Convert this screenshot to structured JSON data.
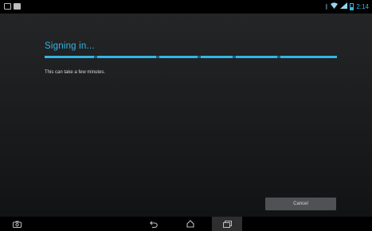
{
  "status_bar": {
    "left_icons": [
      "gallery-icon",
      "photo-icon"
    ],
    "right_icons": [
      "bluetooth-icon",
      "wifi-icon",
      "battery-icon"
    ],
    "time": "2:14"
  },
  "dialog": {
    "title": "Signing in...",
    "message": "This can take a few minutes.",
    "cancel_label": "Cancel"
  },
  "nav_bar": {
    "buttons": [
      "screenshot-icon",
      "back-icon",
      "home-icon",
      "recent-apps-icon"
    ]
  },
  "colors": {
    "accent": "#33b5e5",
    "background": "#1c1d1f",
    "button": "#4f5153"
  }
}
